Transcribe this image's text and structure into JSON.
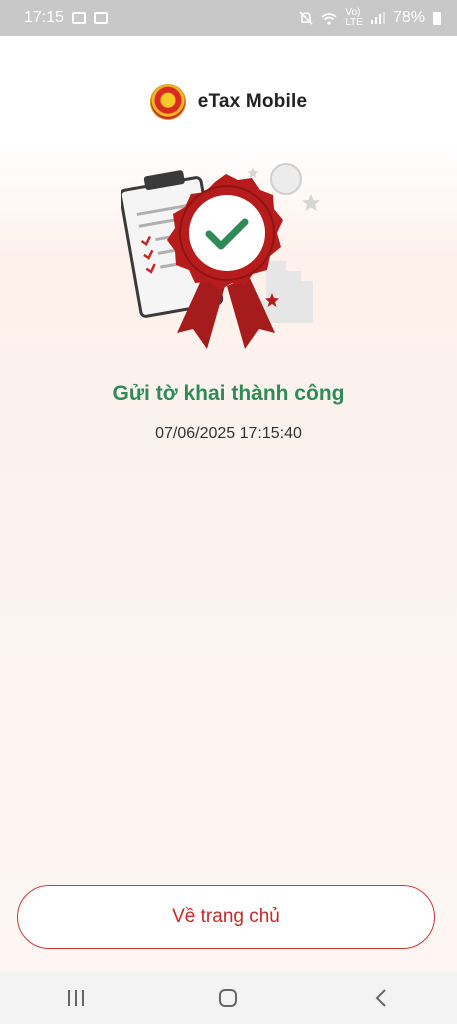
{
  "status_bar": {
    "time": "17:15",
    "network": "Vo)",
    "network_sub": "LTE",
    "battery": "78%"
  },
  "header": {
    "app_name": "eTax Mobile",
    "logo_icon": "national-emblem-icon"
  },
  "result": {
    "illustration": "success-certificate-icon",
    "title": "Gửi tờ khai thành công",
    "datetime": "07/06/2025 17:15:40",
    "accent_color": "#2e8b57"
  },
  "actions": {
    "home_label": "Về trang chủ",
    "button_color": "#c62828"
  },
  "nav_bar": {
    "recent_icon": "recent-apps-icon",
    "home_icon": "home-icon",
    "back_icon": "back-icon"
  }
}
